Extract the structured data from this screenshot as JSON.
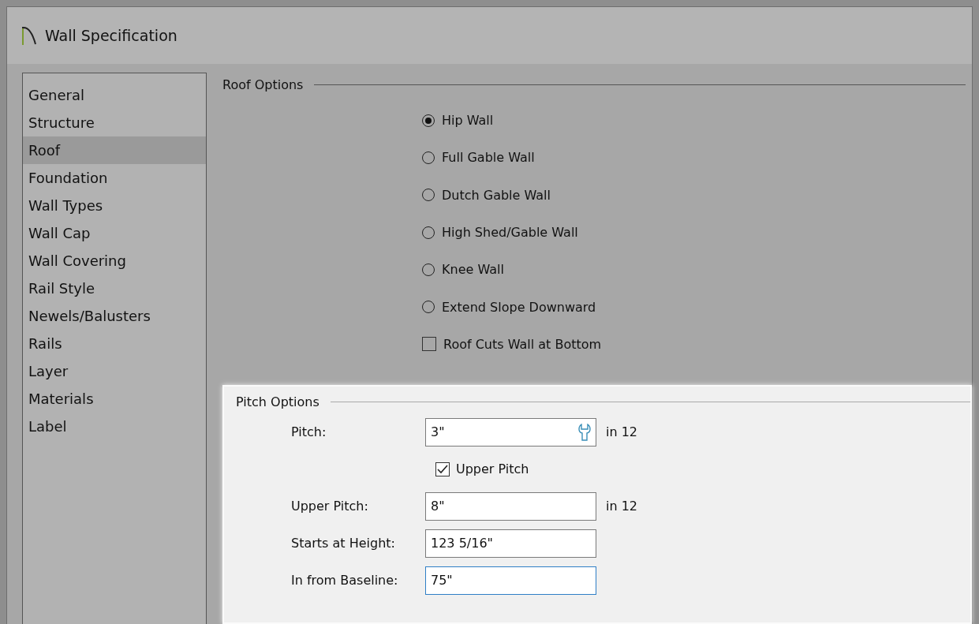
{
  "window": {
    "title": "Wall Specification"
  },
  "sidebar": {
    "items": [
      {
        "label": "General",
        "selected": false
      },
      {
        "label": "Structure",
        "selected": false
      },
      {
        "label": "Roof",
        "selected": true
      },
      {
        "label": "Foundation",
        "selected": false
      },
      {
        "label": "Wall Types",
        "selected": false
      },
      {
        "label": "Wall Cap",
        "selected": false
      },
      {
        "label": "Wall Covering",
        "selected": false
      },
      {
        "label": "Rail Style",
        "selected": false
      },
      {
        "label": "Newels/Balusters",
        "selected": false
      },
      {
        "label": "Rails",
        "selected": false
      },
      {
        "label": "Layer",
        "selected": false
      },
      {
        "label": "Materials",
        "selected": false
      },
      {
        "label": "Label",
        "selected": false
      }
    ]
  },
  "roof_options": {
    "title": "Roof Options",
    "options": [
      {
        "kind": "radio",
        "label": "Hip Wall",
        "selected": true
      },
      {
        "kind": "radio",
        "label": "Full Gable Wall",
        "selected": false
      },
      {
        "kind": "radio",
        "label": "Dutch Gable Wall",
        "selected": false
      },
      {
        "kind": "radio",
        "label": "High Shed/Gable Wall",
        "selected": false
      },
      {
        "kind": "radio",
        "label": "Knee Wall",
        "selected": false
      },
      {
        "kind": "radio",
        "label": "Extend Slope Downward",
        "selected": false
      },
      {
        "kind": "checkbox",
        "label": "Roof Cuts Wall at Bottom",
        "checked": false
      }
    ]
  },
  "pitch_options": {
    "title": "Pitch Options",
    "rows": [
      {
        "kind": "field",
        "label": "Pitch:",
        "value": "3\"",
        "unit": "in 12",
        "tool": true,
        "focused": false
      },
      {
        "kind": "checkbox",
        "label": "Upper Pitch",
        "checked": true
      },
      {
        "kind": "field",
        "label": "Upper Pitch:",
        "value": "8\"",
        "unit": "in 12",
        "tool": false,
        "focused": false
      },
      {
        "kind": "field",
        "label": "Starts at Height:",
        "value": "123 5/16\"",
        "tool": false,
        "focused": false
      },
      {
        "kind": "field",
        "label": "In from Baseline:",
        "value": "75\"",
        "tool": false,
        "focused": true
      }
    ]
  }
}
